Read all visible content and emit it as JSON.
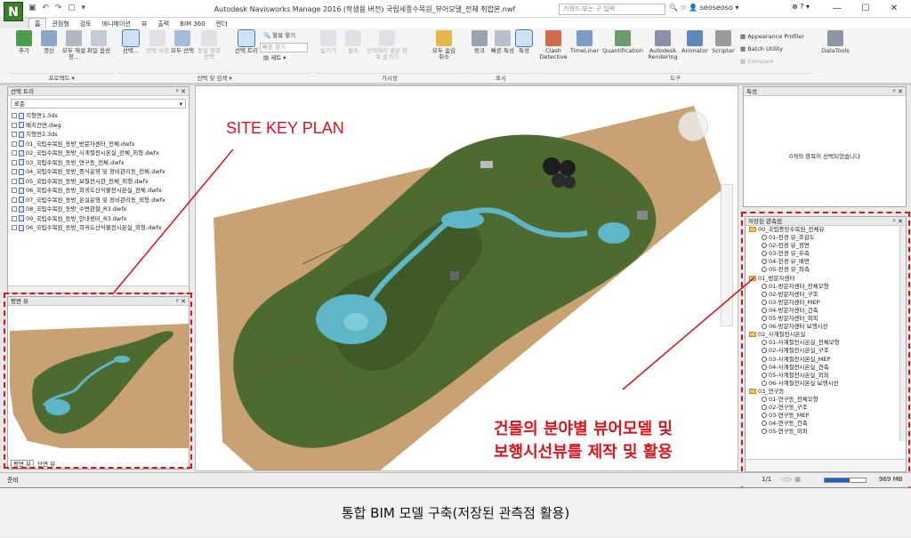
{
  "app": {
    "logo": "N",
    "window_title": "Autodesk Navisworks Manage 2016 (학생용 버전)    국립세종수목원_뷰어모델_전체 취합본.nwf",
    "search_placeholder": "키워드 또는 구 입력",
    "username": "seoseoso",
    "help": "?"
  },
  "tabs": [
    "홈",
    "관점형",
    "검토",
    "애니메이션",
    "뷰",
    "출력",
    "BIM 360",
    "렌더"
  ],
  "ribbon": {
    "project": {
      "items": [
        "추가",
        "갱신",
        "모두 재설정...",
        "파일 옵션"
      ],
      "group": "프로젝트 ▾"
    },
    "select": {
      "items": [
        "선택...",
        "선택 저장",
        "모두 선택",
        "동일 항목 선택",
        "선택 트리"
      ],
      "find": "항목 찾기",
      "quick_find": "빠른 찾기",
      "set": "세트",
      "group": "선택 및 검색 ▾"
    },
    "visibility": {
      "items": [
        "숨기기",
        "필수",
        "선택하지 않은 항목 숨기기",
        "모두 숨김 취소"
      ],
      "group": "가시성"
    },
    "display": {
      "items": [
        "링크",
        "빠른 특성",
        "특성"
      ],
      "group": "표시"
    },
    "tools": {
      "items": [
        "Clash Detective",
        "TimeLiner",
        "Quantification",
        "Autodesk Rendering",
        "Animator",
        "Scripter"
      ],
      "small": [
        "Appearance Profiler",
        "Batch Utility",
        "Compare"
      ],
      "datatools": "DataTools",
      "group": "도구"
    }
  },
  "selection_tree": {
    "title": "선택 트리",
    "dropdown": "표준",
    "items": [
      "지형면1.3ds",
      "배치건면.dwg",
      "지형면2.3ds",
      "01_국립수목원_동방_방문자센터_전체.dwfx",
      "02_국립수목원_동방_사계절전시온실_전체_외형.dwfx",
      "03_국립수목원_동방_연구동_전체.dwfx",
      "04_국립수목원_동방_중식운영 및 정비관리동_전체.dwfx",
      "05_국립수목원_동방_보절전시관_전체_외형.dwfx",
      "06_국립수목원_동방_희귀도산식물전시온실_전체.dwfx",
      "07_국립수목원_동방_온실운영 및 정비관리동_외형.dwfx",
      "08_국립수목원_동방_수변관찰_R3.dwfx",
      "09_국립수목원_동방_안내센터_R3.dwfx",
      "06_국립수목원_동방_희귀도산식물전시온실_외형.dwfx"
    ]
  },
  "plan_view": {
    "title": "평면 뷰",
    "tabs": [
      "평면 뷰",
      "단면 뷰"
    ]
  },
  "properties": {
    "title": "특성",
    "empty": "0개의 항목이 선택되었습니다"
  },
  "saved_views": {
    "title": "저장된 관측점",
    "items": [
      {
        "type": "folder",
        "label": "00_국립중앙수목원_전체뷰"
      },
      {
        "type": "view",
        "label": "01-전경 뷰_조감도"
      },
      {
        "type": "view",
        "label": "02-전경 뷰_정면"
      },
      {
        "type": "view",
        "label": "03-전경 뷰_우측"
      },
      {
        "type": "view",
        "label": "04-전경 뷰_배면"
      },
      {
        "type": "view",
        "label": "05-전경 뷰_좌측"
      },
      {
        "type": "folder",
        "label": "01_방문자센터"
      },
      {
        "type": "view",
        "label": "01-방문자센터_전체모형"
      },
      {
        "type": "view",
        "label": "02-방문자센터_구조"
      },
      {
        "type": "view",
        "label": "03-방문자센터_MEP"
      },
      {
        "type": "view",
        "label": "04-방문자센터_건축"
      },
      {
        "type": "view",
        "label": "05-방문자센터_외피"
      },
      {
        "type": "view",
        "label": "06-방문자센터 보행시선"
      },
      {
        "type": "folder",
        "label": "02_사계절전시온실"
      },
      {
        "type": "view",
        "label": "01-사계절전시온실_전체모형"
      },
      {
        "type": "view",
        "label": "02-사계절전시온실_구조"
      },
      {
        "type": "view",
        "label": "03-사계절전시온실_MEP"
      },
      {
        "type": "view",
        "label": "04-사계절전시온실_건축"
      },
      {
        "type": "view",
        "label": "05-사계절전시온실_외피"
      },
      {
        "type": "view",
        "label": "06-사계절전시온실 보행시선"
      },
      {
        "type": "folder",
        "label": "03_연구동"
      },
      {
        "type": "view",
        "label": "01-연구동_전체모형"
      },
      {
        "type": "view",
        "label": "02-연구동_구조"
      },
      {
        "type": "view",
        "label": "03-연구동_MEP"
      },
      {
        "type": "view",
        "label": "04-연구동_건축"
      },
      {
        "type": "view",
        "label": "05-연구동_외피"
      }
    ]
  },
  "status": {
    "left": "준비",
    "page": "1/1",
    "memory": "969 MB"
  },
  "annotations": {
    "site_key_plan": "SITE KEY PLAN",
    "line1": "건물의 분야별 뷰어모델 및",
    "line2": "보행시선뷰를 제작 및 활용"
  },
  "caption": "통합 BIM 모델 구축(저장된 관측점 활용)",
  "colors": {
    "annotation": "#d8141c",
    "terrain_green": "#4d6b30",
    "ground": "#c9a274",
    "water": "#5fb6c7"
  }
}
